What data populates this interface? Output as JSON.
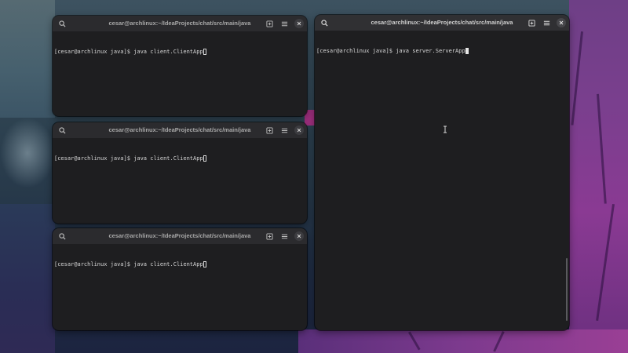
{
  "wallpaper": {
    "description_colors": {
      "hair": "#7a3f8e",
      "bg": "#2f4452"
    }
  },
  "terminals": [
    {
      "id": "client-1",
      "title": "cesar@archlinux:~/IdeaProjects/chat/src/main/java",
      "prompt": "[cesar@archlinux java]$ ",
      "command": "java client.ClientApp",
      "active": false
    },
    {
      "id": "client-2",
      "title": "cesar@archlinux:~/IdeaProjects/chat/src/main/java",
      "prompt": "[cesar@archlinux java]$ ",
      "command": "java client.ClientApp",
      "active": false
    },
    {
      "id": "client-3",
      "title": "cesar@archlinux:~/IdeaProjects/chat/src/main/java",
      "prompt": "[cesar@archlinux java]$ ",
      "command": "java client.ClientApp",
      "active": false
    },
    {
      "id": "server",
      "title": "cesar@archlinux:~/IdeaProjects/chat/src/main/java",
      "prompt": "[cesar@archlinux java]$ ",
      "command": "java server.ServerApp",
      "active": true
    }
  ],
  "icons": {
    "search": "search-icon",
    "new_tab": "new-tab-icon",
    "menu": "hamburger-menu-icon",
    "close": "close-icon"
  },
  "colors": {
    "terminal_bg": "#1e1e20",
    "titlebar_active": "#303033",
    "titlebar_inactive": "#2b2b2e",
    "text": "#d7d7d7"
  }
}
